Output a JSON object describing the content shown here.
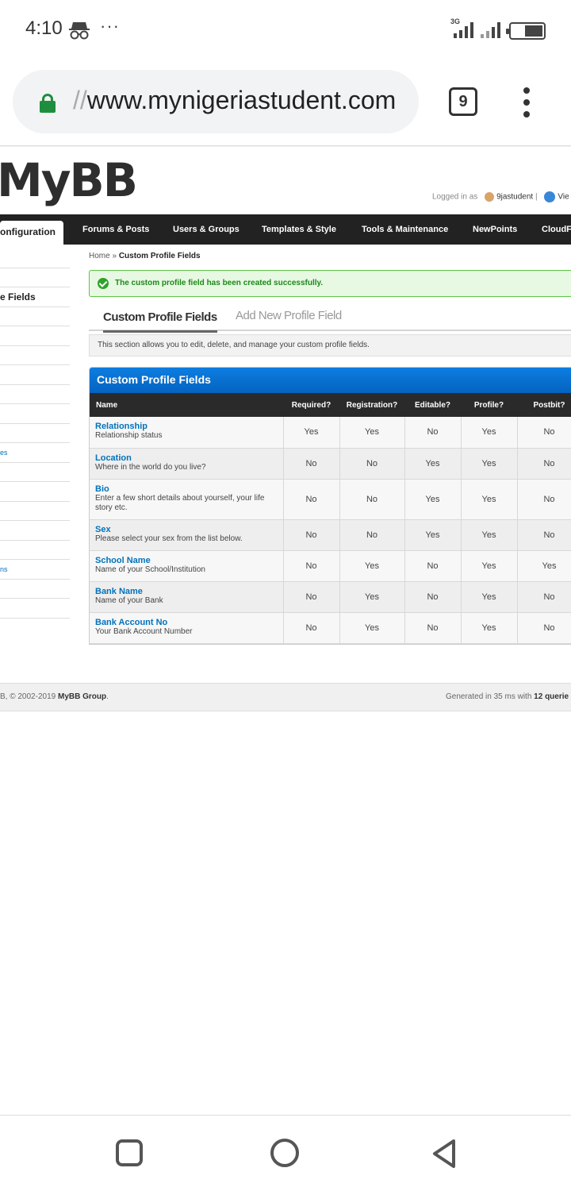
{
  "status": {
    "time": "4:10",
    "network": "3G",
    "more": "···"
  },
  "browser": {
    "url_prefix": "//",
    "url_host": "www.mynigeriastudent.com",
    "tab_count": "9"
  },
  "site": {
    "logo": "MyBB",
    "logged_in_label": "Logged in as",
    "username": "9jastudent",
    "separator": "|",
    "view_site": "Vie"
  },
  "nav": {
    "active": "onfiguration",
    "items": [
      "Forums & Posts",
      "Users & Groups",
      "Templates & Style",
      "Tools & Maintenance",
      "NewPoints",
      "CloudF"
    ]
  },
  "sidebar": {
    "items": [
      "",
      "",
      "e Fields",
      "",
      "",
      "",
      "",
      "",
      "",
      "",
      "es",
      "",
      "",
      "",
      "",
      "",
      "ns",
      "",
      ""
    ]
  },
  "breadcrumb": {
    "home": "Home",
    "sep": "»",
    "current": "Custom Profile Fields"
  },
  "message": {
    "success": "The custom profile field has been created successfully."
  },
  "tabs": {
    "active": "Custom Profile Fields",
    "inactive": "Add New Profile Field"
  },
  "description": "This section allows you to edit, delete, and manage your custom profile fields.",
  "table": {
    "title": "Custom Profile Fields",
    "headers": [
      "Name",
      "Required?",
      "Registration?",
      "Editable?",
      "Profile?",
      "Postbit?"
    ],
    "rows": [
      {
        "name": "Relationship",
        "desc": "Relationship status",
        "required": "Yes",
        "registration": "Yes",
        "editable": "No",
        "profile": "Yes",
        "postbit": "No"
      },
      {
        "name": "Location",
        "desc": "Where in the world do you live?",
        "required": "No",
        "registration": "No",
        "editable": "Yes",
        "profile": "Yes",
        "postbit": "No"
      },
      {
        "name": "Bio",
        "desc": "Enter a few short details about yourself, your life story etc.",
        "required": "No",
        "registration": "No",
        "editable": "Yes",
        "profile": "Yes",
        "postbit": "No"
      },
      {
        "name": "Sex",
        "desc": "Please select your sex from the list below.",
        "required": "No",
        "registration": "No",
        "editable": "Yes",
        "profile": "Yes",
        "postbit": "No"
      },
      {
        "name": "School Name",
        "desc": "Name of your School/Institution",
        "required": "No",
        "registration": "Yes",
        "editable": "No",
        "profile": "Yes",
        "postbit": "Yes"
      },
      {
        "name": "Bank Name",
        "desc": "Name of your Bank",
        "required": "No",
        "registration": "Yes",
        "editable": "No",
        "profile": "Yes",
        "postbit": "No"
      },
      {
        "name": "Bank Account No",
        "desc": "Your Bank Account Number",
        "required": "No",
        "registration": "Yes",
        "editable": "No",
        "profile": "Yes",
        "postbit": "No"
      }
    ]
  },
  "footer": {
    "copy_prefix": "B, © 2002-2019 ",
    "copy_group": "MyBB Group",
    "copy_suffix": ".",
    "gen_prefix": "Generated in 35 ms with ",
    "gen_bold": "12 querie"
  }
}
